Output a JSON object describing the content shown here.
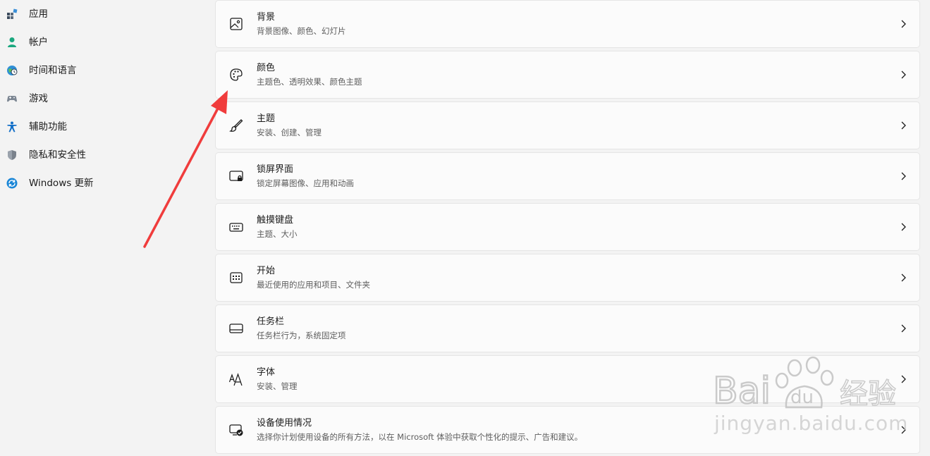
{
  "sidebar": {
    "items": [
      {
        "label": "应用",
        "icon": "apps-icon"
      },
      {
        "label": "帐户",
        "icon": "account-icon"
      },
      {
        "label": "时间和语言",
        "icon": "time-language-icon"
      },
      {
        "label": "游戏",
        "icon": "gaming-icon"
      },
      {
        "label": "辅助功能",
        "icon": "accessibility-icon"
      },
      {
        "label": "隐私和安全性",
        "icon": "privacy-shield-icon"
      },
      {
        "label": "Windows 更新",
        "icon": "windows-update-icon"
      }
    ]
  },
  "cards": [
    {
      "title": "背景",
      "subtitle": "背景图像、颜色、幻灯片",
      "icon": "image-icon"
    },
    {
      "title": "颜色",
      "subtitle": "主题色、透明效果、颜色主题",
      "icon": "palette-icon"
    },
    {
      "title": "主题",
      "subtitle": "安装、创建、管理",
      "icon": "brush-icon"
    },
    {
      "title": "锁屏界面",
      "subtitle": "锁定屏幕图像、应用和动画",
      "icon": "lock-screen-icon"
    },
    {
      "title": "触摸键盘",
      "subtitle": "主题、大小",
      "icon": "keyboard-icon"
    },
    {
      "title": "开始",
      "subtitle": "最近使用的应用和项目、文件夹",
      "icon": "start-menu-icon"
    },
    {
      "title": "任务栏",
      "subtitle": "任务栏行为，系统固定项",
      "icon": "taskbar-icon"
    },
    {
      "title": "字体",
      "subtitle": "安装、管理",
      "icon": "fonts-icon"
    },
    {
      "title": "设备使用情况",
      "subtitle": "选择你计划使用设备的所有方法，以在 Microsoft 体验中获取个性化的提示、广告和建议。",
      "icon": "device-usage-icon"
    }
  ],
  "watermark": {
    "brand": "Baidu经验",
    "url": "jingyan.baidu.com"
  },
  "colors": {
    "accent": "#0067c0",
    "annotation": "#f03c3c",
    "background": "#f3f3f3",
    "card": "#fbfbfb"
  }
}
